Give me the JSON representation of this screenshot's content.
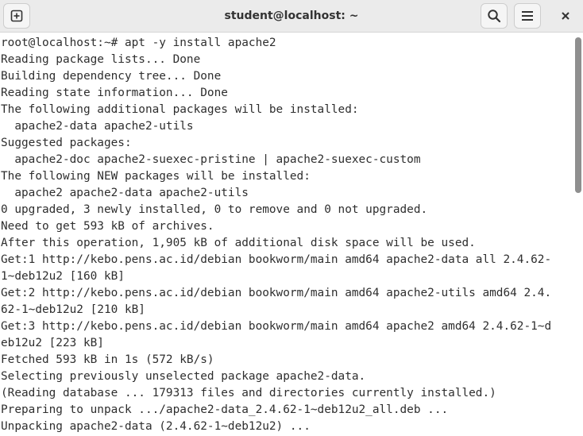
{
  "window": {
    "title": "student@localhost: ~"
  },
  "icons": {
    "new_tab": "new-tab-icon",
    "search": "search-icon",
    "menu": "hamburger-menu-icon",
    "close": "close-icon"
  },
  "colors": {
    "titlebar_bg": "#ebebeb",
    "terminal_bg": "#ffffff",
    "terminal_fg": "#2e2e2e",
    "scroll_thumb": "#8f8f8f"
  },
  "terminal": {
    "lines": [
      "root@localhost:~# apt -y install apache2",
      "Reading package lists... Done",
      "Building dependency tree... Done",
      "Reading state information... Done",
      "The following additional packages will be installed:",
      "  apache2-data apache2-utils",
      "Suggested packages:",
      "  apache2-doc apache2-suexec-pristine | apache2-suexec-custom",
      "The following NEW packages will be installed:",
      "  apache2 apache2-data apache2-utils",
      "0 upgraded, 3 newly installed, 0 to remove and 0 not upgraded.",
      "Need to get 593 kB of archives.",
      "After this operation, 1,905 kB of additional disk space will be used.",
      "Get:1 http://kebo.pens.ac.id/debian bookworm/main amd64 apache2-data all 2.4.62-",
      "1~deb12u2 [160 kB]",
      "Get:2 http://kebo.pens.ac.id/debian bookworm/main amd64 apache2-utils amd64 2.4.",
      "62-1~deb12u2 [210 kB]",
      "Get:3 http://kebo.pens.ac.id/debian bookworm/main amd64 apache2 amd64 2.4.62-1~d",
      "eb12u2 [223 kB]",
      "Fetched 593 kB in 1s (572 kB/s)",
      "Selecting previously unselected package apache2-data.",
      "(Reading database ... 179313 files and directories currently installed.)",
      "Preparing to unpack .../apache2-data_2.4.62-1~deb12u2_all.deb ...",
      "Unpacking apache2-data (2.4.62-1~deb12u2) ..."
    ]
  }
}
